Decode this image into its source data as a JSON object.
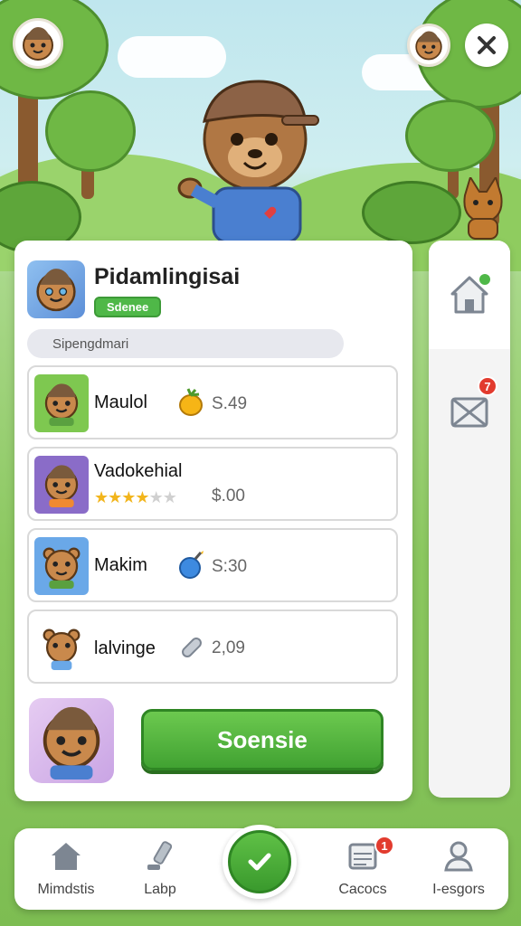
{
  "header": {
    "player_avatar": "bear-avatar-icon",
    "friend_avatar": "bear-avatar-icon",
    "close_icon": "close-icon"
  },
  "profile": {
    "title": "Pidamlingisai",
    "badge": "Sdenee",
    "search_placeholder": "Sipengdmari"
  },
  "items": [
    {
      "name": "Maulol",
      "price": "S.49",
      "icon": "fruit-icon",
      "pic_color": "#7ec850"
    },
    {
      "name": "Vadokehial",
      "price": "$.00",
      "rating": 4,
      "rating_max": 6,
      "pic_color": "#8a6cc8"
    },
    {
      "name": "Makim",
      "price": "S:30",
      "icon": "bomb-icon",
      "pic_color": "#6aa8e8"
    },
    {
      "name": "lalvinge",
      "price": "2,09",
      "icon": "bandage-icon",
      "pic_color": "#ffffff"
    }
  ],
  "action_button": "Soensie",
  "side_tabs": [
    {
      "icon": "home-icon",
      "notification": ""
    },
    {
      "icon": "map-icon",
      "notification": "7"
    }
  ],
  "nav": {
    "items": [
      {
        "label": "Mimdstis",
        "icon": "house-icon"
      },
      {
        "label": "Labp",
        "icon": "hammer-icon"
      },
      {
        "label": "",
        "icon": "checkmark-icon"
      },
      {
        "label": "Cacocs",
        "icon": "calendar-icon",
        "notification": "1"
      },
      {
        "label": "I-esgors",
        "icon": "profile-icon"
      }
    ]
  },
  "colors": {
    "accent": "#4fb848",
    "notification": "#e23b2e"
  }
}
